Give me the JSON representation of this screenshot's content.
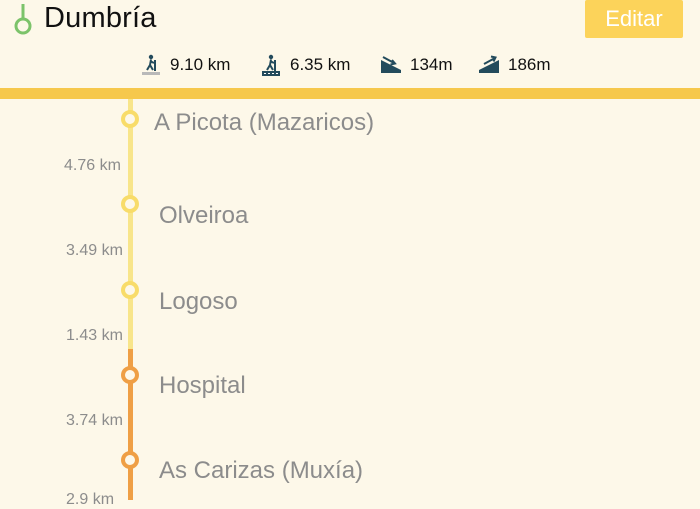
{
  "header": {
    "title": "Dumbría",
    "edit_label": "Editar",
    "route_icon": "route-pin-icon"
  },
  "stats": [
    {
      "icon": "hiker-flat-icon",
      "value": "9.10 km"
    },
    {
      "icon": "hiker-road-icon",
      "value": "6.35 km"
    },
    {
      "icon": "descent-icon",
      "value": "134m"
    },
    {
      "icon": "ascent-icon",
      "value": "186m"
    }
  ],
  "colors": {
    "accent": "#f6c84c",
    "button": "#fcd35a",
    "line_light": "#f8e58a",
    "line_orange": "#ef9f45",
    "text_gray": "#8c8c8c"
  },
  "stops": [
    {
      "name": "A Picota (Mazaricos)",
      "style": "yellow"
    },
    {
      "name": "Olveiroa",
      "style": "yellow"
    },
    {
      "name": "Logoso",
      "style": "yellow"
    },
    {
      "name": "Hospital",
      "style": "orange"
    },
    {
      "name": "As Carizas (Muxía)",
      "style": "orange"
    }
  ],
  "distances": [
    "4.76 km",
    "3.49 km",
    "1.43 km",
    "3.74 km",
    "2.9 km"
  ]
}
